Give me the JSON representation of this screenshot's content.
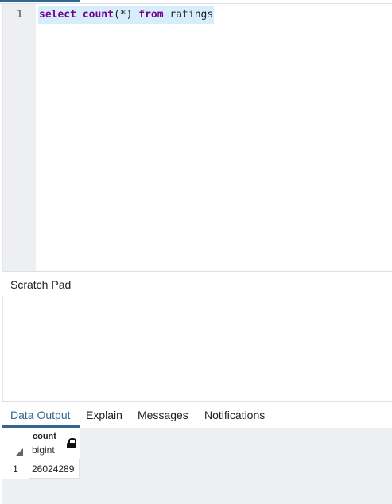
{
  "editor": {
    "line_number": "1",
    "code": {
      "kw_select": "select",
      "fn_count": "count",
      "args": "(*)",
      "kw_from": "from",
      "table": "ratings"
    }
  },
  "scratch_pad": {
    "title": "Scratch Pad"
  },
  "tabs": [
    {
      "label": "Data Output",
      "active": true
    },
    {
      "label": "Explain",
      "active": false
    },
    {
      "label": "Messages",
      "active": false
    },
    {
      "label": "Notifications",
      "active": false
    }
  ],
  "results": {
    "columns": [
      {
        "name": "count",
        "type": "bigint",
        "icon": "lock-icon"
      }
    ],
    "rows": [
      {
        "row_number": "1",
        "cells": [
          "26024289"
        ]
      }
    ]
  },
  "colors": {
    "accent": "#326690",
    "keyword": "#770088",
    "selection": "#d6eefb"
  }
}
